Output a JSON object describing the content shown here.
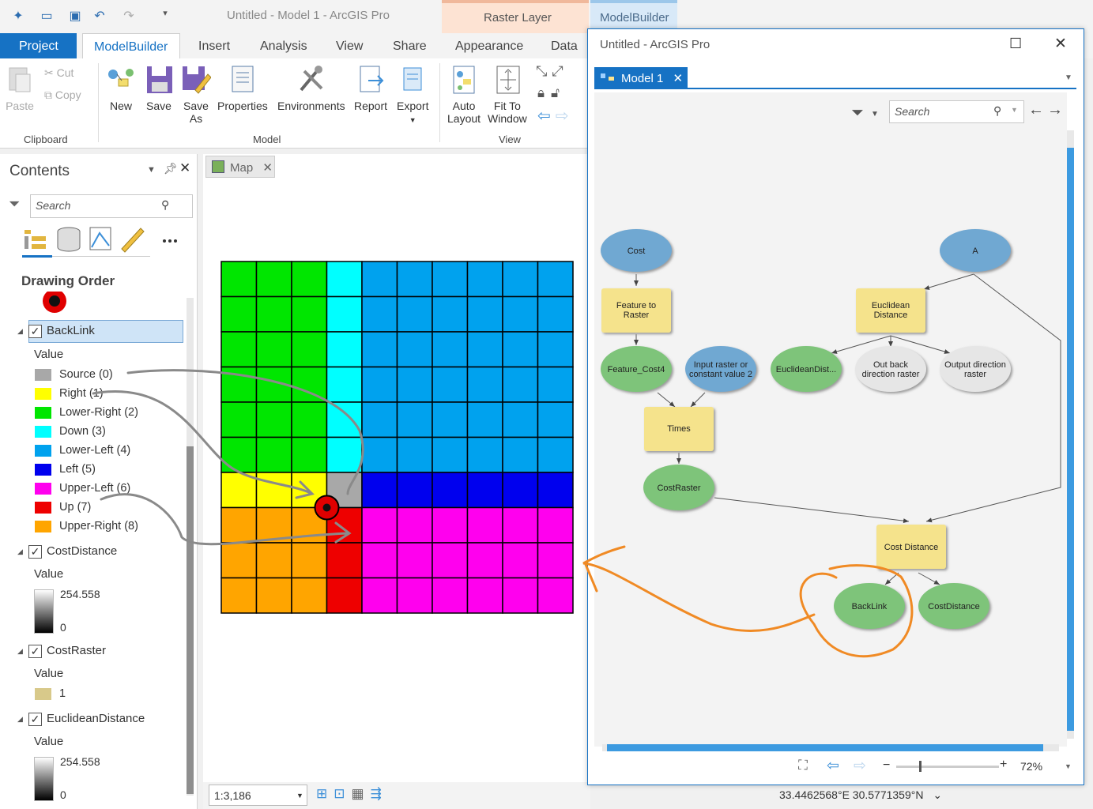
{
  "titlebar": {
    "app_title": "Untitled - Model 1 - ArcGIS Pro",
    "context_raster": "Raster Layer",
    "context_modelbuilder": "ModelBuilder"
  },
  "tabs": [
    "Project",
    "ModelBuilder",
    "Insert",
    "Analysis",
    "View",
    "Share",
    "Appearance",
    "Data"
  ],
  "ribbon": {
    "clipboard": {
      "paste": "Paste",
      "cut": "Cut",
      "copy": "Copy",
      "group": "Clipboard"
    },
    "model": {
      "new": "New",
      "save": "Save",
      "save_as_1": "Save",
      "save_as_2": "As",
      "properties": "Properties",
      "environments": "Environments",
      "report": "Report",
      "export": "Export",
      "group": "Model"
    },
    "view": {
      "auto_1": "Auto",
      "auto_2": "Layout",
      "fit_1": "Fit To",
      "fit_2": "Window",
      "group": "View"
    }
  },
  "contents": {
    "title": "Contents",
    "search_placeholder": "Search",
    "drawing_order": "Drawing Order",
    "layers": [
      {
        "name": "BackLink",
        "value_label": "Value",
        "legend": [
          {
            "label": "Source (0)",
            "color": "#a8a8a8"
          },
          {
            "label": "Right (1)",
            "color": "#ffff00"
          },
          {
            "label": "Lower-Right (2)",
            "color": "#00e600"
          },
          {
            "label": "Down (3)",
            "color": "#00ffff"
          },
          {
            "label": "Lower-Left (4)",
            "color": "#00a2ee"
          },
          {
            "label": "Left (5)",
            "color": "#0000ee"
          },
          {
            "label": "Upper-Left (6)",
            "color": "#ff00ee"
          },
          {
            "label": "Up (7)",
            "color": "#ee0000"
          },
          {
            "label": "Upper-Right (8)",
            "color": "#ffa500"
          }
        ]
      },
      {
        "name": "CostDistance",
        "value_label": "Value",
        "max": "254.558",
        "min": "0"
      },
      {
        "name": "CostRaster",
        "value_label": "Value",
        "single": "1",
        "single_color": "#d8c98a"
      },
      {
        "name": "EuclideanDistance",
        "value_label": "Value",
        "max": "254.558",
        "min": "0"
      }
    ]
  },
  "map": {
    "tab_label": "Map",
    "scale": "1:3,186",
    "coords": "33.4462568°E 30.5771359°N",
    "grid": [
      [
        2,
        2,
        2,
        3,
        4,
        4,
        4,
        4,
        4,
        4
      ],
      [
        2,
        2,
        2,
        3,
        4,
        4,
        4,
        4,
        4,
        4
      ],
      [
        2,
        2,
        2,
        3,
        4,
        4,
        4,
        4,
        4,
        4
      ],
      [
        2,
        2,
        2,
        3,
        4,
        4,
        4,
        4,
        4,
        4
      ],
      [
        2,
        2,
        2,
        3,
        4,
        4,
        4,
        4,
        4,
        4
      ],
      [
        2,
        2,
        2,
        3,
        4,
        4,
        4,
        4,
        4,
        4
      ],
      [
        1,
        1,
        1,
        0,
        5,
        5,
        5,
        5,
        5,
        5
      ],
      [
        8,
        8,
        8,
        7,
        6,
        6,
        6,
        6,
        6,
        6
      ],
      [
        8,
        8,
        8,
        7,
        6,
        6,
        6,
        6,
        6,
        6
      ],
      [
        8,
        8,
        8,
        7,
        6,
        6,
        6,
        6,
        6,
        6
      ]
    ]
  },
  "modelbuilder": {
    "window_title": "Untitled - ArcGIS Pro",
    "tab": "Model 1",
    "search_placeholder": "Search",
    "zoom": "72%",
    "nodes": {
      "cost": "Cost",
      "feature_to_raster_1": "Feature to",
      "feature_to_raster_2": "Raster",
      "feature_cost4": "Feature_Cost4",
      "input_raster_1": "Input raster or",
      "input_raster_2": "constant value 2",
      "times": "Times",
      "costraster": "CostRaster",
      "a": "A",
      "euclidean_1": "Euclidean",
      "euclidean_2": "Distance",
      "euclidean_out": "EuclideanDist...",
      "out_back_1": "Out back",
      "out_back_2": "direction raster",
      "out_dir_1": "Output direction",
      "out_dir_2": "raster",
      "cost_distance": "Cost Distance",
      "backlink": "BackLink",
      "costdistance_out": "CostDistance"
    }
  }
}
